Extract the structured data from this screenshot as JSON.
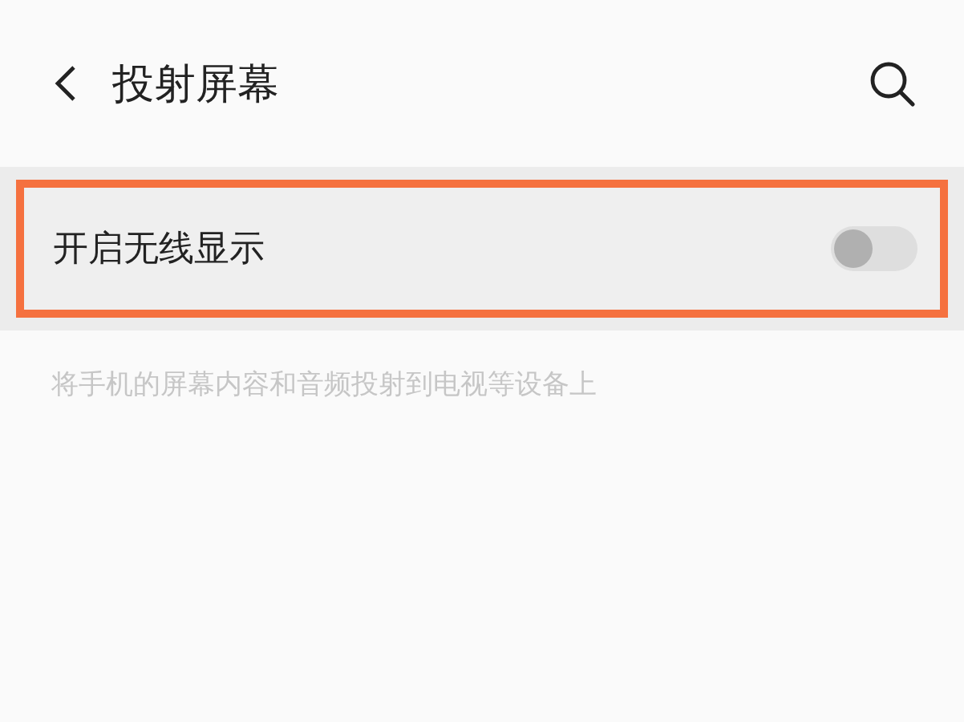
{
  "header": {
    "title": "投射屏幕"
  },
  "setting": {
    "label": "开启无线显示",
    "on": false,
    "highlighted": true
  },
  "description": "将手机的屏幕内容和音频投射到电视等设备上"
}
